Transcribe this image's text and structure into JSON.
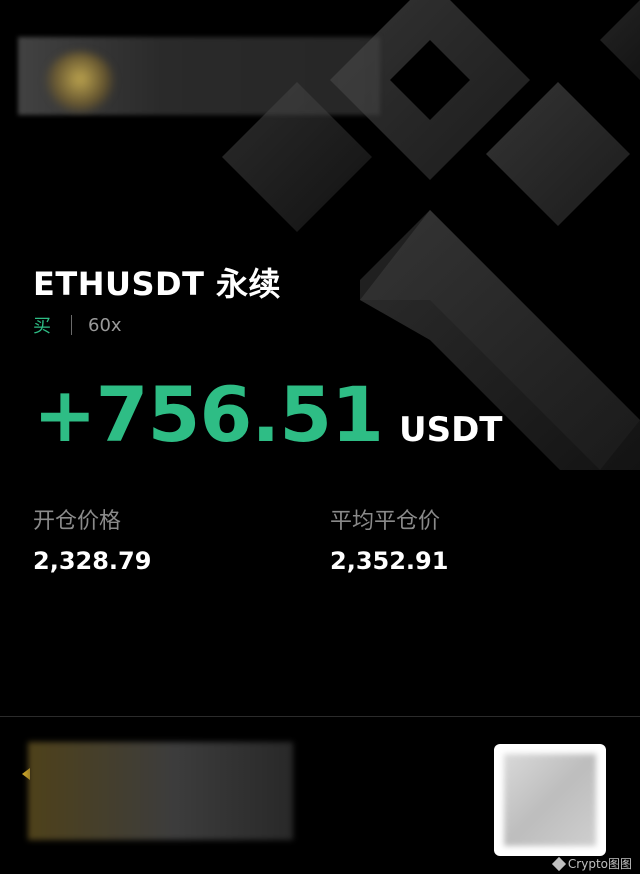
{
  "position": {
    "symbol": "ETHUSDT 永续",
    "side": "买",
    "leverage": "60x",
    "pnl": "+756.51",
    "pnl_unit": "USDT"
  },
  "stats": {
    "entry_label": "开仓价格",
    "entry_value": "2,328.79",
    "close_label": "平均平仓价",
    "close_value": "2,352.91"
  },
  "watermark": {
    "text": "Crypto图图"
  },
  "colors": {
    "profit": "#2ebd85",
    "background": "#000000",
    "muted": "#8a8a8a"
  },
  "icons": {
    "background": "diamond-pattern-icon",
    "watermark": "wechat-icon"
  }
}
